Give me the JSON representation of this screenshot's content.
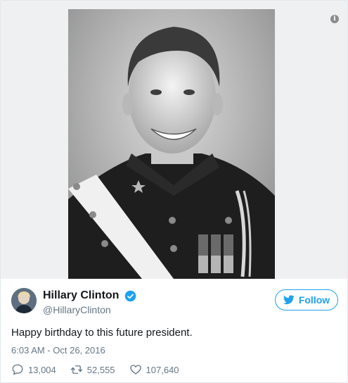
{
  "media": {
    "info_icon_symbol": "i",
    "photo_alt": "Black and white portrait of a smiling young man in a military academy dress uniform"
  },
  "author": {
    "display_name": "Hillary Clinton",
    "handle": "@HillaryClinton",
    "verified": true,
    "avatar_icon": "avatar-photo"
  },
  "follow_button": {
    "label": "Follow",
    "icon": "twitter-bird-icon"
  },
  "tweet": {
    "text": "Happy birthday to this future president.",
    "timestamp": "6:03 AM - Oct 26, 2016"
  },
  "actions": {
    "replies": "13,004",
    "retweets": "52,555",
    "likes": "107,640"
  },
  "colors": {
    "accent": "#1da1f2",
    "secondary_text": "#657786",
    "border": "#e1e8ed"
  }
}
